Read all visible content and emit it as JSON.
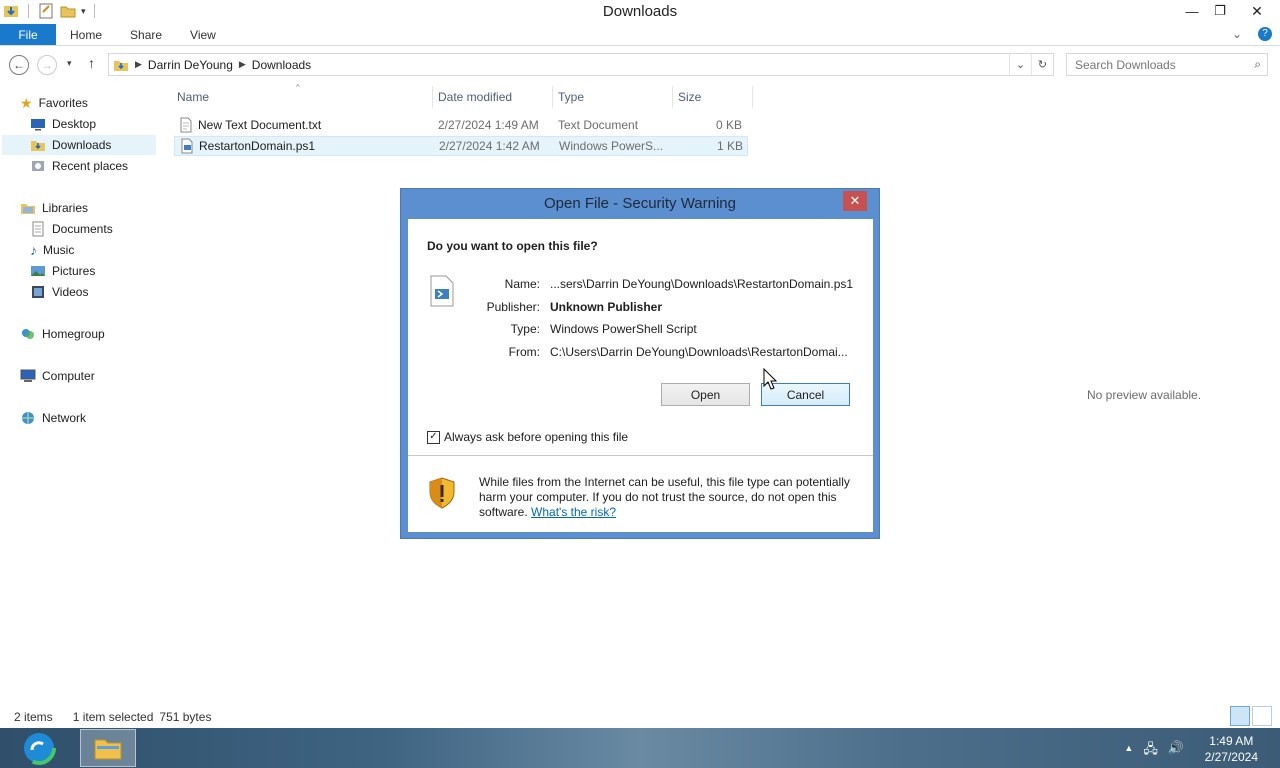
{
  "window": {
    "title": "Downloads",
    "minimize_glyph": "—",
    "maximize_glyph": "❐",
    "close_glyph": "✕"
  },
  "ribbon": {
    "tabs": [
      "File",
      "Home",
      "Share",
      "View"
    ],
    "expand_glyph": "⌄",
    "help_glyph": "?"
  },
  "address": {
    "back_glyph": "←",
    "forward_glyph": "→",
    "recent_glyph": "▾",
    "up_glyph": "↑",
    "crumbs": [
      "Darrin DeYoung",
      "Downloads"
    ],
    "dropdown_glyph": "⌄",
    "refresh_glyph": "↻"
  },
  "search": {
    "placeholder": "Search Downloads",
    "icon_glyph": "⌕"
  },
  "nav_pane": {
    "favorites": "Favorites",
    "desktop": "Desktop",
    "downloads": "Downloads",
    "recent": "Recent places",
    "libraries": "Libraries",
    "documents": "Documents",
    "music": "Music",
    "pictures": "Pictures",
    "videos": "Videos",
    "homegroup": "Homegroup",
    "computer": "Computer",
    "network": "Network"
  },
  "file_list": {
    "columns": [
      "Name",
      "Date modified",
      "Type",
      "Size"
    ],
    "sort_glyph": "^",
    "rows": [
      {
        "name": "New Text Document.txt",
        "date": "2/27/2024 1:49 AM",
        "type": "Text Document",
        "size": "0 KB"
      },
      {
        "name": "RestartonDomain.ps1",
        "date": "2/27/2024 1:42 AM",
        "type": "Windows PowerS...",
        "size": "1 KB"
      }
    ],
    "preview": "No preview available."
  },
  "status": {
    "items": "2 items",
    "selected": "1 item selected",
    "bytes": "751 bytes"
  },
  "dialog": {
    "title": "Open File - Security Warning",
    "close_glyph": "✕",
    "question": "Do you want to open this file?",
    "name_label": "Name:",
    "name_value": "...sers\\Darrin DeYoung\\Downloads\\RestartonDomain.ps1",
    "publisher_label": "Publisher:",
    "publisher_value": "Unknown Publisher",
    "type_label": "Type:",
    "type_value": "Windows PowerShell Script",
    "from_label": "From:",
    "from_value": "C:\\Users\\Darrin DeYoung\\Downloads\\RestartonDomai...",
    "open_label": "Open",
    "cancel_label": "Cancel",
    "always_ask": "Always ask before opening this file",
    "always_ask_checked": true,
    "check_glyph": "✓",
    "warning_text": "While files from the Internet can be useful, this file type can potentially harm your computer. If you do not trust the source, do not open this software.",
    "risk_link": "What's the risk?"
  },
  "taskbar": {
    "tray_up": "▲",
    "tray_network": "🖧",
    "tray_volume": "🔊",
    "time": "1:49 AM",
    "date": "2/27/2024"
  },
  "colors": {
    "file_tab": "#1979ca",
    "selection": "#e5f3fb",
    "dialog_frame": "#5c8fd0",
    "close_red": "#c75050",
    "link": "#0066cc"
  }
}
